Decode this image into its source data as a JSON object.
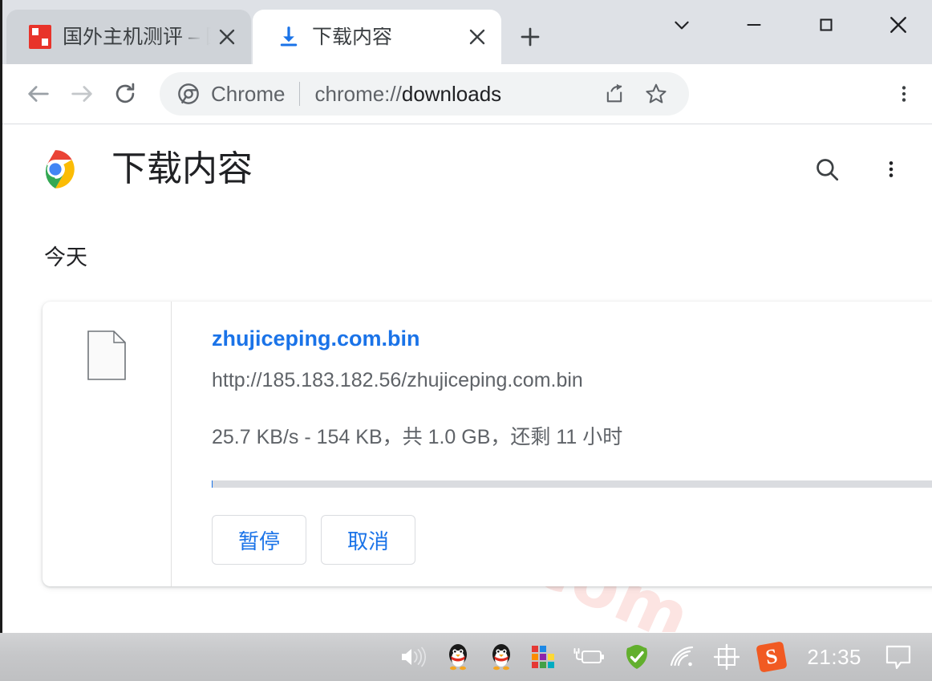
{
  "window": {
    "tabs": [
      {
        "title": "国外主机测评 – 国",
        "favicon": "site-favicon-red",
        "active": false,
        "close_label": "×"
      },
      {
        "title": "下载内容",
        "favicon": "download-icon",
        "active": true,
        "close_label": "×"
      }
    ],
    "new_tab_label": "+",
    "controls": {
      "tab_search_label": "⌄",
      "minimize_label": "—",
      "maximize_label": "□",
      "close_label": "✕"
    }
  },
  "toolbar": {
    "back_icon": "arrow-left-icon",
    "forward_icon": "arrow-right-icon",
    "reload_icon": "reload-icon",
    "omnibox": {
      "scheme_label": "Chrome",
      "url_prefix": "chrome://",
      "url_path": "downloads",
      "full_url": "chrome://downloads",
      "share_icon": "share-icon",
      "bookmark_icon": "star-icon"
    },
    "menu_icon": "three-dots-vertical-icon"
  },
  "page": {
    "title": "下载内容",
    "logo": "chrome-logo",
    "search_icon": "search-icon",
    "menu_icon": "three-dots-vertical-icon",
    "date_group": "今天",
    "watermark": "zhujiceping.com",
    "download": {
      "file_icon": "generic-file-icon",
      "file_name": "zhujiceping.com.bin",
      "source_url": "http://185.183.182.56/zhujiceping.com.bin",
      "status": "25.7 KB/s - 154 KB，共 1.0 GB，还剩 11 小时",
      "speed": "25.7 KB/s",
      "downloaded": "154 KB",
      "total_size": "1.0 GB",
      "time_remaining": "11 小时",
      "progress_percent": 0.02,
      "pause_label": "暂停",
      "cancel_label": "取消"
    }
  },
  "taskbar": {
    "clock": "21:35",
    "tray": [
      {
        "name": "volume-icon"
      },
      {
        "name": "qq-penguin-icon"
      },
      {
        "name": "qq-penguin-icon-2"
      },
      {
        "name": "color-grid-icon"
      },
      {
        "name": "battery-charging-icon"
      },
      {
        "name": "security-check-icon"
      },
      {
        "name": "wifi-icon"
      },
      {
        "name": "ime-chinese-icon",
        "label": "中"
      },
      {
        "name": "sogou-input-icon",
        "label": "S"
      }
    ],
    "notification_icon": "notification-bubble-icon"
  },
  "colors": {
    "accent_blue": "#1a73e8",
    "tabstrip_bg": "#dee1e6",
    "inactive_tab": "#cfd3d8",
    "omnibox_bg": "#f1f3f4",
    "text_primary": "#202124",
    "text_secondary": "#5f6368",
    "watermark_pink": "#fce4e2",
    "taskbar_gray": "#c6c7c9",
    "progress_track": "#dadce0"
  }
}
